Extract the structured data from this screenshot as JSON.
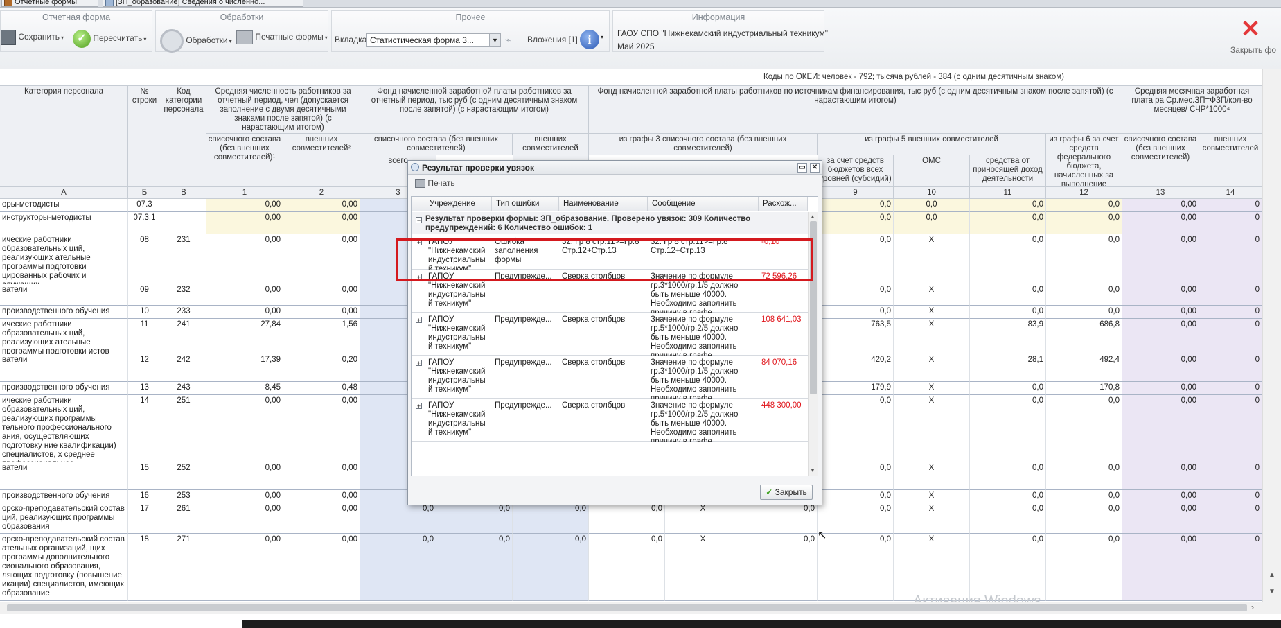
{
  "tabs": [
    {
      "label": "Отчетные формы"
    },
    {
      "label": "[ЗП_образование] Сведения о численно..."
    }
  ],
  "ribbon": {
    "groups": {
      "report_form": "Отчетная форма",
      "processing": "Обработки",
      "other": "Прочее",
      "info": "Информация"
    },
    "save": "Сохранить",
    "recalc": "Пересчитать",
    "processing_btn": "Обработки",
    "print_forms": "Печатные формы",
    "tab_label": "Вкладка",
    "tab_value": "Статистическая форма 3...",
    "attachments": "Вложения [1]",
    "info_org": "ГАОУ СПО \"Нижнекамский индустриальный техникум\"",
    "info_period": "Май 2025",
    "close": "Закрыть фо"
  },
  "grid": {
    "okei_note": "Коды по ОКЕИ: человек - 792; тысяча рублей - 384 (с одним десятичным знаком)",
    "headers": {
      "category": "Категория персонала",
      "row_no": "№ строки",
      "cat_code": "Код категории персонала",
      "avg_count": "Средняя численность работников за отчетный период, чел (допускается заполнение с двумя десятичными знаками после запятой) (с нарастающим итогом)",
      "fund": "Фонд начисленной заработной платы работников за отчетный период, тыс руб (с одним десятичным знаком после запятой) (с нарастающим итогом)",
      "fund_src": "Фонд начисленной заработной платы работников по источникам финансирования, тыс руб (с одним десятичным знаком после запятой) (с нарастающим итогом)",
      "avg_monthly": "Средняя месячная заработная плата ра Ср.мес.ЗП=ФЗП/кол-во месяцев/ СЧР*1000⁴",
      "list_staff_1": "списочного состава (без внешних совместителей)¹",
      "external_2": "внешних совместителей²",
      "list_staff_fund": "списочного состава (без внешних совместителей)",
      "external_fund": "внешних совместителей",
      "from_col3": "из графы 3 списочного состава (без внешних совместителей)",
      "from_col5": "из графы 5 внешних совместителей",
      "from_col6": "из графы 6 за счет средств федерального бюджета, начисленных за выполнение",
      "budget_subsidy": "за счет средств бюджетов всех уровней (субсидий)",
      "oms": "ОМС",
      "income_funds": "средства от приносящей доход деятельности",
      "total_short": "всего",
      "avg_list": "списочного состава (без внешних совместителей)",
      "avg_ext": "внешних совместителей"
    },
    "col_numbers": [
      "А",
      "Б",
      "В",
      "1",
      "2",
      "3",
      "9",
      "10",
      "11",
      "12",
      "13",
      "14"
    ],
    "rows": [
      {
        "label": "оры-методисты",
        "no": "07.3",
        "code": "",
        "c1": "0,00",
        "c2": "0,00",
        "c9": "0,0",
        "c10": "0,0",
        "c11": "0,0",
        "c12": "0,0",
        "c13": "0,00",
        "c14": "0"
      },
      {
        "label": "инструкторы-методисты",
        "no": "07.3.1",
        "code": "",
        "c1": "0,00",
        "c2": "0,00",
        "c9": "0,0",
        "c10": "0,0",
        "c11": "0,0",
        "c12": "0,0",
        "c13": "0,00",
        "c14": "0"
      },
      {
        "label": "ические работники образовательных ций, реализующих ательные программы подготовки цированных рабочих и служащих",
        "no": "08",
        "code": "231",
        "c1": "0,00",
        "c2": "0,00",
        "c9": "0,0",
        "c10": "X",
        "c11": "0,0",
        "c12": "0,0",
        "c13": "0,00",
        "c14": "0"
      },
      {
        "label": "ватели",
        "no": "09",
        "code": "232",
        "c1": "0,00",
        "c2": "0,00",
        "c9": "0,0",
        "c10": "X",
        "c11": "0,0",
        "c12": "0,0",
        "c13": "0,00",
        "c14": "0"
      },
      {
        "label": "производственного обучения",
        "no": "10",
        "code": "233",
        "c1": "0,00",
        "c2": "0,00",
        "c9": "0,0",
        "c10": "X",
        "c11": "0,0",
        "c12": "0,0",
        "c13": "0,00",
        "c14": "0"
      },
      {
        "label": "ические работники образовательных ций, реализующих ательные программы подготовки истов среднего звена",
        "no": "11",
        "code": "241",
        "c1": "27,84",
        "c2": "1,56",
        "c9": "763,5",
        "c10": "X",
        "c11": "83,9",
        "c12": "686,8",
        "c13": "0,00",
        "c14": "0"
      },
      {
        "label": "ватели",
        "no": "12",
        "code": "242",
        "c1": "17,39",
        "c2": "0,20",
        "c9": "420,2",
        "c10": "X",
        "c11": "28,1",
        "c12": "492,4",
        "c13": "0,00",
        "c14": "0"
      },
      {
        "label": "производственного обучения",
        "no": "13",
        "code": "243",
        "c1": "8,45",
        "c2": "0,48",
        "c9": "179,9",
        "c10": "X",
        "c11": "0,0",
        "c12": "170,8",
        "c13": "0,00",
        "c14": "0"
      },
      {
        "label": "ические работники образовательных ций, реализующих программы тельного профессионального ания, осуществляющих подготовку ние квалификации) специалистов, х среднее профессиональное",
        "no": "14",
        "code": "251",
        "c1": "0,00",
        "c2": "0,00",
        "c9": "0,0",
        "c10": "X",
        "c11": "0,0",
        "c12": "0,0",
        "c13": "0,00",
        "c14": "0"
      },
      {
        "label": "ватели",
        "no": "15",
        "code": "252",
        "c1": "0,00",
        "c2": "0,00",
        "c9": "0,0",
        "c10": "X",
        "c11": "0,0",
        "c12": "0,0",
        "c13": "0,00",
        "c14": "0"
      },
      {
        "label": "производственного обучения",
        "no": "16",
        "code": "253",
        "c1": "0,00",
        "c2": "0,00",
        "c9": "0,0",
        "c10": "X",
        "c11": "0,0",
        "c12": "0,0",
        "c13": "0,00",
        "c14": "0"
      },
      {
        "label": "орско-преподавательский состав ций, реализующих программы образования",
        "no": "17",
        "code": "261",
        "c1": "0,00",
        "c2": "0,00",
        "c3": "0,0",
        "c4": "0,0",
        "c5": "0,0",
        "c6": "0,0",
        "c7": "X",
        "c8": "0,0",
        "c9": "0,0",
        "c10": "X",
        "c11": "0,0",
        "c12": "0,0",
        "c13": "0,00",
        "c14": "0"
      },
      {
        "label": "орско-преподавательский состав ательных организаций, щих программы дополнительного сионального образования, ляющих подготовку (повышение икации) специалистов, имеющих образование",
        "no": "18",
        "code": "271",
        "c1": "0,00",
        "c2": "0,00",
        "c3": "0,0",
        "c4": "0,0",
        "c5": "0,0",
        "c6": "0,0",
        "c7": "X",
        "c8": "0,0",
        "c9": "0,0",
        "c10": "X",
        "c11": "0,0",
        "c12": "0,0",
        "c13": "0,00",
        "c14": "0"
      }
    ],
    "watermark": "Активация Windows"
  },
  "dialog": {
    "title": "Результат проверки увязок",
    "print": "Печать",
    "columns": [
      "Учреждение",
      "Тип ошибки",
      "Наименование",
      "Сообщение",
      "Расхож..."
    ],
    "group_header": "Результат проверки формы: ЗП_образование. Проверено увязок: 309 Количество предупреждений: 6 Количество ошибок: 1",
    "rows": [
      {
        "org": "ГАПОУ \"Нижнекамский индустриальный техникум\"",
        "type": "Ошибка заполнения формы",
        "name": "32. Гр 8 стр.11>=Гр.8 Стр.12+Стр.13",
        "message": "32. Гр 8 стр.11>=Гр.8 Стр.12+Стр.13",
        "diff": "-0,10"
      },
      {
        "org": "ГАПОУ \"Нижнекамский индустриальный техникум\"",
        "type": "Предупрежде...",
        "name": "Сверка столбцов",
        "message": "Значение по формуле гр.3*1000/гр.1/5 должно быть меньше 40000. Необходимо заполнить причину в графе Примечание",
        "diff": "72 596,26"
      },
      {
        "org": "ГАПОУ \"Нижнекамский индустриальный техникум\"",
        "type": "Предупрежде...",
        "name": "Сверка столбцов",
        "message": "Значение по формуле гр.5*1000/гр.2/5 должно быть меньше 40000. Необходимо заполнить причину в графе Примечание",
        "diff": "108 641,03"
      },
      {
        "org": "ГАПОУ \"Нижнекамский индустриальный техникум\"",
        "type": "Предупрежде...",
        "name": "Сверка столбцов",
        "message": "Значение по формуле гр.3*1000/гр.1/5 должно быть меньше 40000. Необходимо заполнить причину в графе Примечание",
        "diff": "84 070,16"
      },
      {
        "org": "ГАПОУ \"Нижнекамский индустриальный техникум\"",
        "type": "Предупрежде...",
        "name": "Сверка столбцов",
        "message": "Значение по формуле гр.5*1000/гр.2/5 должно быть меньше 40000. Необходимо заполнить причину в графе Примечание",
        "diff": "448 300,00"
      }
    ],
    "close_button": "Закрыть"
  },
  "colors": {
    "error_text": "#e0151b",
    "highlight_border": "#d4191e",
    "yellow_cell": "#fbf7de",
    "blue_cell": "#dfe6f4",
    "purple_cell": "#ebe6f4"
  }
}
